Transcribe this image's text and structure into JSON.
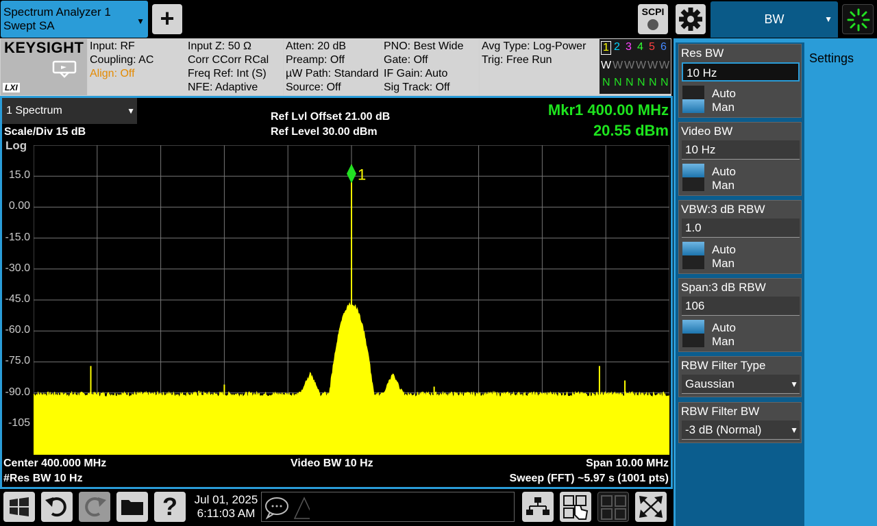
{
  "app": {
    "name_line1": "Spectrum Analyzer 1",
    "name_line2": "Swept SA",
    "menu_tab": "BW",
    "scpi_label": "SCPI"
  },
  "info": {
    "logo": "KEYSIGHT",
    "lxi": "LXI",
    "col1": [
      "Input: RF",
      "Coupling: AC",
      "Align: Off"
    ],
    "col2": [
      "Input Z: 50 Ω",
      "Corr CCorr RCal",
      "Freq Ref: Int (S)",
      "NFE: Adaptive"
    ],
    "col3": [
      "Atten: 20 dB",
      "Preamp: Off",
      "µW Path: Standard",
      "Source: Off"
    ],
    "col4": [
      "PNO: Best Wide",
      "Gate: Off",
      "IF Gain: Auto",
      "Sig Track: Off"
    ],
    "col5": [
      "Avg Type: Log-Power",
      "Trig: Free Run"
    ],
    "traces": {
      "numbers": [
        "1",
        "2",
        "3",
        "4",
        "5",
        "6"
      ],
      "number_colors": [
        "#ffff00",
        "#00d4ff",
        "#ff44ff",
        "#33ff33",
        "#ff4040",
        "#4488ff"
      ],
      "types": [
        "W",
        "W",
        "W",
        "W",
        "W",
        "W"
      ],
      "detectors": [
        "N",
        "N",
        "N",
        "N",
        "N",
        "N"
      ]
    }
  },
  "graph": {
    "window_select": "1 Spectrum",
    "scale": "Scale/Div 15 dB",
    "scale_type": "Log",
    "ref_offset": "Ref Lvl Offset 21.00 dB",
    "ref_level": "Ref Level 30.00 dBm",
    "marker_freq": "Mkr1 400.00 MHz",
    "marker_amp": "20.55 dBm",
    "marker_label": "1",
    "y_ticks": [
      "15.0",
      "0.00",
      "-15.0",
      "-30.0",
      "-45.0",
      "-60.0",
      "-75.0",
      "-90.0",
      "-105"
    ],
    "center": "Center 400.000 MHz",
    "res_bw": "#Res BW 10 Hz",
    "video_bw": "Video BW 10 Hz",
    "span": "Span 10.00 MHz",
    "sweep": "Sweep (FFT) ~5.97 s  (1001 pts)"
  },
  "chart_data": {
    "type": "area",
    "y_top": 30,
    "y_per_div": 15,
    "divisions": 10,
    "noise_floor": -92,
    "center_mhz": 400,
    "span_mhz": 10,
    "peak": {
      "x_mhz": 400.0,
      "y_dbm": 20.55
    },
    "spurs": [
      {
        "x_mhz": 395.9,
        "y_dbm": -77
      },
      {
        "x_mhz": 397.0,
        "y_dbm": -90
      },
      {
        "x_mhz": 397.6,
        "y_dbm": -89
      },
      {
        "x_mhz": 398.0,
        "y_dbm": -86
      },
      {
        "x_mhz": 403.9,
        "y_dbm": -77
      },
      {
        "x_mhz": 404.3,
        "y_dbm": -84
      },
      {
        "x_mhz": 401.3,
        "y_dbm": -87
      }
    ]
  },
  "panel": {
    "settings_tab": "Settings",
    "res_bw": {
      "title": "Res BW",
      "value": "10 Hz",
      "auto": "Auto",
      "man": "Man"
    },
    "video_bw": {
      "title": "Video BW",
      "value": "10 Hz",
      "auto": "Auto",
      "man": "Man"
    },
    "vbw_ratio": {
      "title": "VBW:3 dB RBW",
      "value": "1.0",
      "auto": "Auto",
      "man": "Man"
    },
    "span_ratio": {
      "title": "Span:3 dB RBW",
      "value": "106",
      "auto": "Auto",
      "man": "Man"
    },
    "filter_type": {
      "title": "RBW Filter Type",
      "value": "Gaussian"
    },
    "filter_bw": {
      "title": "RBW Filter BW",
      "value": "-3 dB (Normal)"
    }
  },
  "bottom": {
    "date": "Jul 01, 2025",
    "time": "6:11:03 AM"
  }
}
